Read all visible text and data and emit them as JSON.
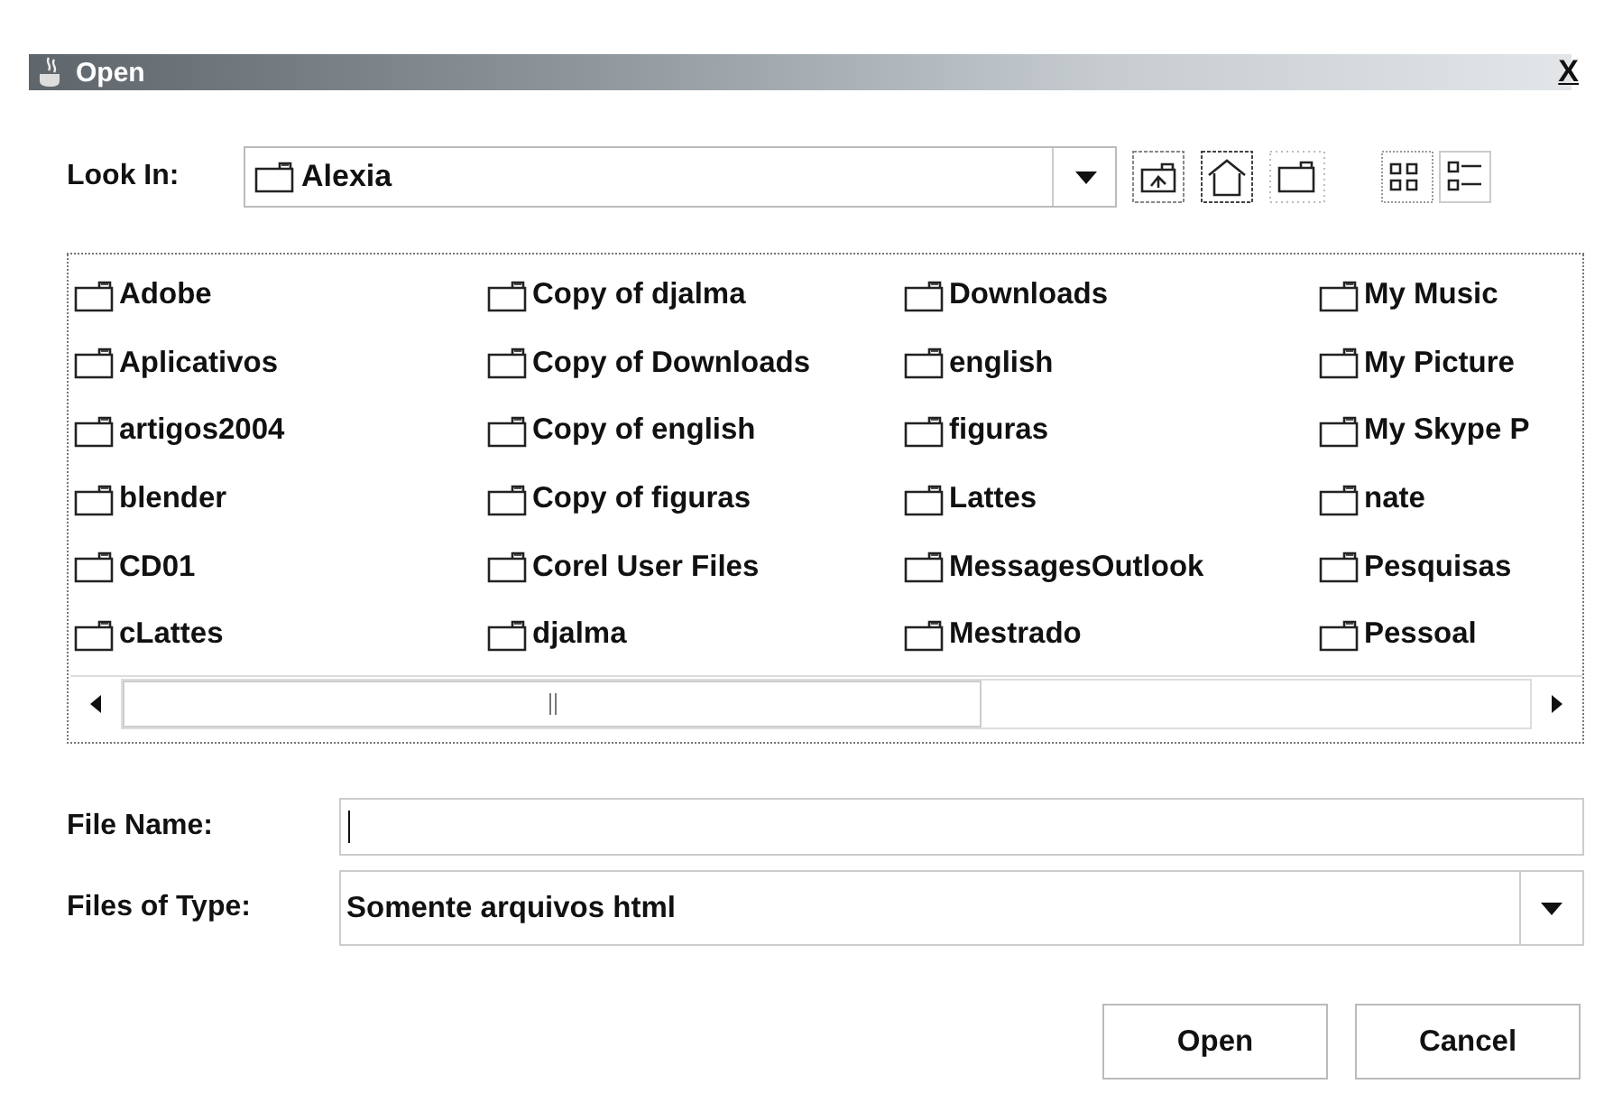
{
  "window": {
    "title": "Open",
    "close": "X"
  },
  "look_in": {
    "label": "Look In:",
    "value": "Alexia"
  },
  "folders": [
    "Adobe",
    "Aplicativos",
    "artigos2004",
    "blender",
    "CD01",
    "cLattes",
    "Copy of djalma",
    "Copy of Downloads",
    "Copy of english",
    "Copy of figuras",
    "Corel User Files",
    "djalma",
    "Downloads",
    "english",
    "figuras",
    "Lattes",
    "MessagesOutlook",
    "Mestrado",
    "My Music",
    "My Picture",
    "My Skype P",
    "nate",
    "Pesquisas",
    "Pessoal"
  ],
  "file_name": {
    "label": "File Name:"
  },
  "file_type": {
    "label": "Files of Type:",
    "value": "Somente arquivos html"
  },
  "buttons": [
    "Open",
    "Cancel"
  ]
}
